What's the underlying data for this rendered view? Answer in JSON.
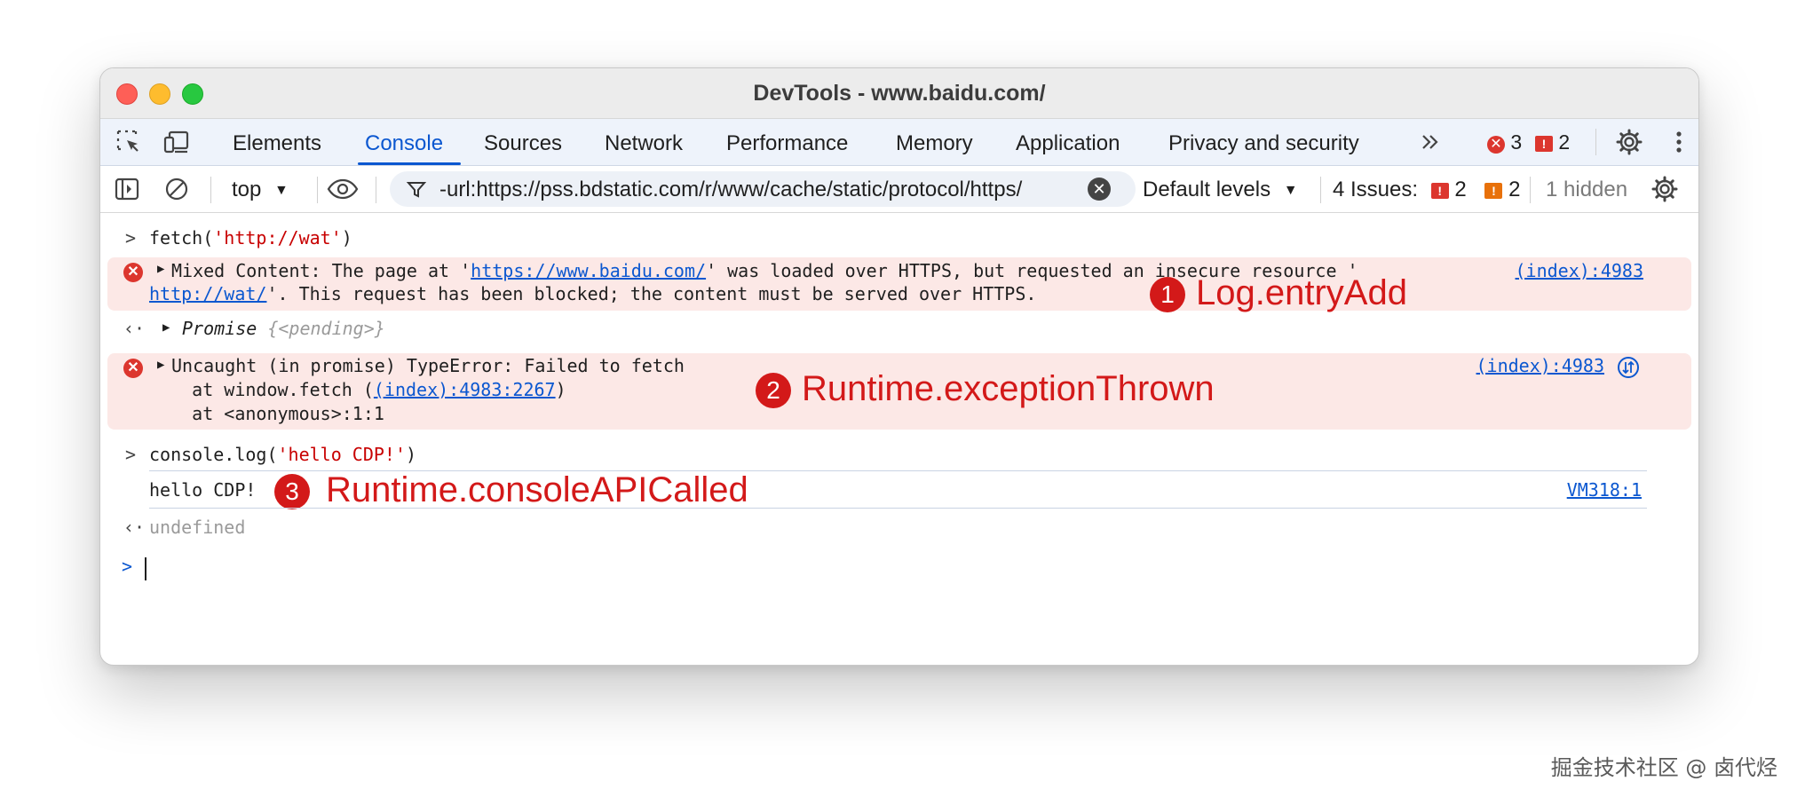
{
  "window": {
    "title": "DevTools - www.baidu.com/"
  },
  "tabs": [
    {
      "label": "Elements"
    },
    {
      "label": "Console"
    },
    {
      "label": "Sources"
    },
    {
      "label": "Network"
    },
    {
      "label": "Performance"
    },
    {
      "label": "Memory"
    },
    {
      "label": "Application"
    },
    {
      "label": "Privacy and security"
    }
  ],
  "active_tab": "Console",
  "tab_badges": {
    "errors": "3",
    "messages": "2"
  },
  "toolbar": {
    "context": "top",
    "filter_value": "-url:https://pss.bdstatic.com/r/www/cache/static/protocol/https/",
    "levels": "Default levels",
    "issues_label": "4 Issues:",
    "issues_errors": "2",
    "issues_warnings": "2",
    "hidden": "1 hidden"
  },
  "console": {
    "cmd1_pre": "fetch(",
    "cmd1_str": "'http://wat'",
    "cmd1_post": ")",
    "err1_pre": "Mixed Content: The page at '",
    "err1_link1": "https://www.baidu.com/",
    "err1_mid": "' was loaded over HTTPS, but requested an insecure resource '",
    "err1_link2": "http://wat/",
    "err1_post": "'. This request has been blocked; the content must be served over HTTPS.",
    "err1_source": "(index):4983",
    "result1_name": "Promise",
    "result1_value": "{<pending>}",
    "err2_line1": "Uncaught (in promise) TypeError: Failed to fetch",
    "err2_line2_pre": "    at window.fetch (",
    "err2_line2_link": "(index):4983:2267",
    "err2_line2_post": ")",
    "err2_line3": "    at <anonymous>:1:1",
    "err2_source": "(index):4983",
    "cmd2_pre": "console.log(",
    "cmd2_str": "'hello CDP!'",
    "cmd2_post": ")",
    "log_text": "hello CDP!",
    "log_source": "VM318:1",
    "result2": "undefined"
  },
  "annotations": [
    {
      "num": "1",
      "text": "Log.entryAdd"
    },
    {
      "num": "2",
      "text": "Runtime.exceptionThrown"
    },
    {
      "num": "3",
      "text": "Runtime.consoleAPICalled"
    }
  ],
  "watermark": "掘金技术社区 @ 卤代烃",
  "colors": {
    "accent": "#0b57d0",
    "error": "#dc362e",
    "annotation": "#d31919",
    "error_bg": "#fce8e6"
  }
}
